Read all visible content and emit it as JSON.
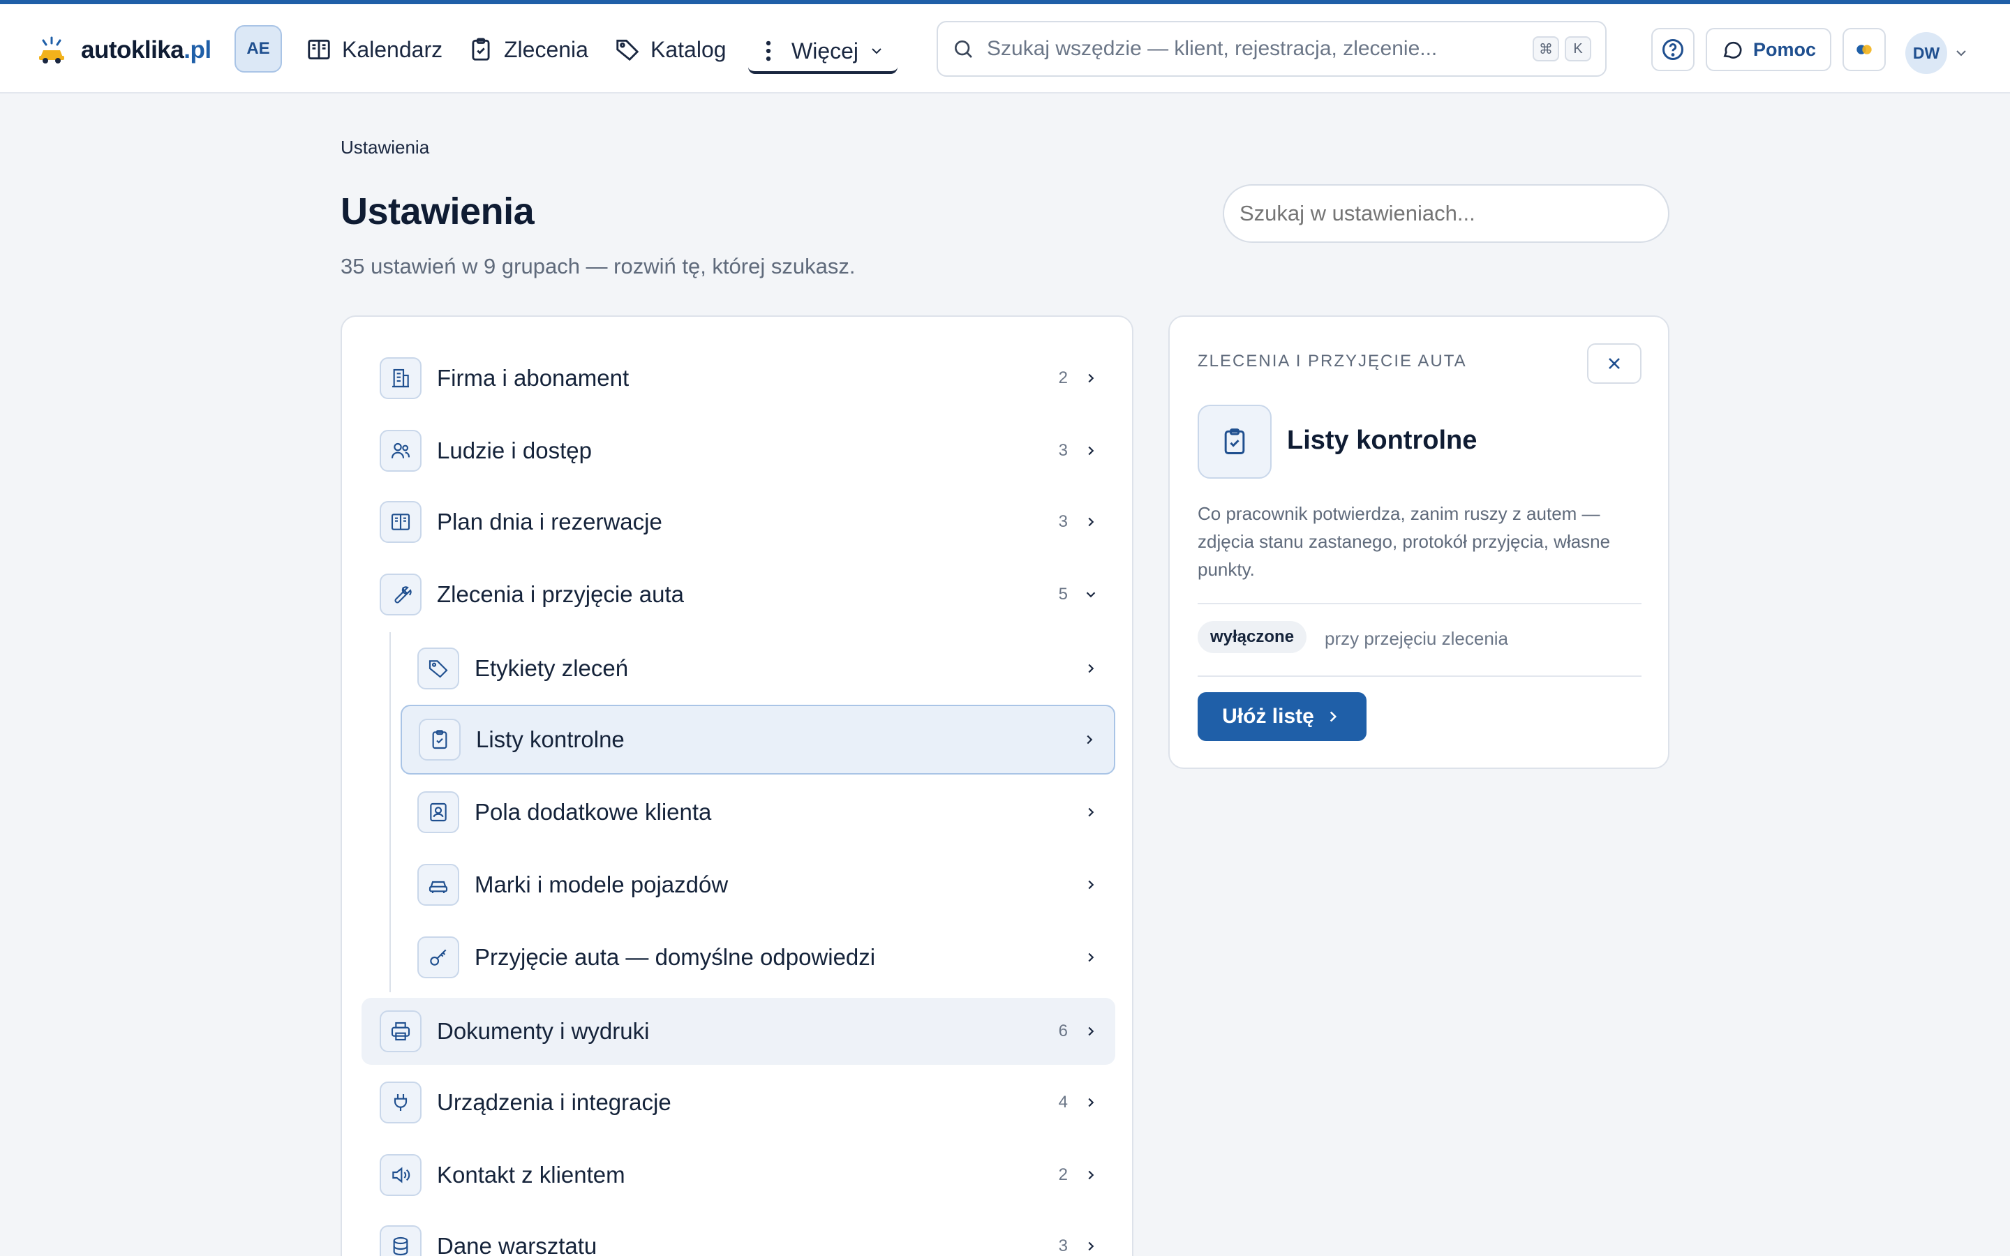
{
  "app": {
    "logo": {
      "name": "autoklika",
      "tld": ".pl"
    },
    "workspace_badge": "AE"
  },
  "nav": {
    "items": [
      {
        "label": "Kalendarz",
        "icon": "calendar-book-icon"
      },
      {
        "label": "Zlecenia",
        "icon": "clipboard-icon"
      },
      {
        "label": "Katalog",
        "icon": "tag-icon"
      },
      {
        "label": "Więcej",
        "icon": "more-vertical-icon"
      }
    ]
  },
  "search": {
    "placeholder": "Szukaj wszędzie — klient, rejestracja, zlecenie...",
    "shortcut": [
      "⌘",
      "K"
    ]
  },
  "header_actions": {
    "help_label": "Pomoc",
    "user_initials": "DW"
  },
  "page": {
    "breadcrumb": "Ustawienia",
    "title": "Ustawienia",
    "subtitle": "35 ustawień w 9 grupach — rozwiń tę, której szukasz.",
    "search_placeholder": "Szukaj w ustawieniach..."
  },
  "groups": [
    {
      "label": "Firma i abonament",
      "count": "2",
      "icon": "building-icon"
    },
    {
      "label": "Ludzie i dostęp",
      "count": "3",
      "icon": "users-icon"
    },
    {
      "label": "Plan dnia i rezerwacje",
      "count": "3",
      "icon": "book-icon"
    },
    {
      "label": "Zlecenia i przyjęcie auta",
      "count": "5",
      "icon": "wrench-icon",
      "expanded": true
    },
    {
      "label": "Dokumenty i wydruki",
      "count": "6",
      "icon": "printer-icon"
    },
    {
      "label": "Urządzenia i integracje",
      "count": "4",
      "icon": "plug-icon"
    },
    {
      "label": "Kontakt z klientem",
      "count": "2",
      "icon": "speaker-icon"
    },
    {
      "label": "Dane warsztatu",
      "count": "3",
      "icon": "database-icon"
    }
  ],
  "children": [
    {
      "label": "Etykiety zleceń",
      "icon": "tag-icon"
    },
    {
      "label": "Listy kontrolne",
      "icon": "clipboard-check-icon",
      "active": true
    },
    {
      "label": "Pola dodatkowe klienta",
      "icon": "contact-card-icon"
    },
    {
      "label": "Marki i modele pojazdów",
      "icon": "car-icon"
    },
    {
      "label": "Przyjęcie auta — domyślne odpowiedzi",
      "icon": "key-icon"
    }
  ],
  "detail": {
    "eyebrow": "ZLECENIA I PRZYJĘCIE AUTA",
    "title": "Listy kontrolne",
    "description": "Co pracownik potwierdza, zanim ruszy z autem — zdjęcia stanu zastanego, protokół przyjęcia, własne punkty.",
    "status": "wyłączone",
    "status_note": "przy przejęciu zlecenia",
    "action_label": "Ułóż listę"
  },
  "colors": {
    "accent": "#1f5fa8",
    "background": "#f3f5f8"
  }
}
